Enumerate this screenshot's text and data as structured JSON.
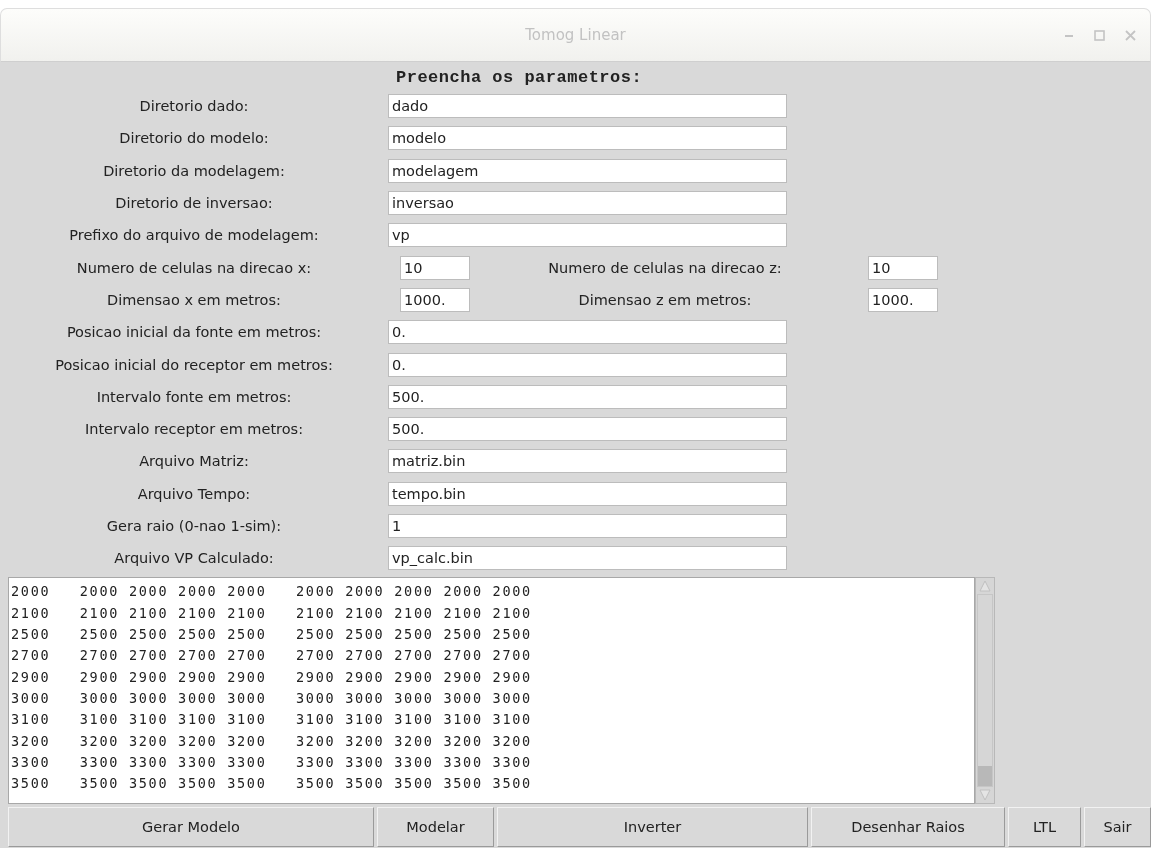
{
  "window": {
    "title": "Tomog Linear"
  },
  "heading": "Preencha os parametros:",
  "rows": [
    {
      "kind": "single",
      "label": "Diretorio dado:",
      "value": "dado"
    },
    {
      "kind": "single",
      "label": "Diretorio do modelo:",
      "value": "modelo"
    },
    {
      "kind": "single",
      "label": "Diretorio da modelagem:",
      "value": "modelagem"
    },
    {
      "kind": "single",
      "label": "Diretorio de inversao:",
      "value": "inversao"
    },
    {
      "kind": "single",
      "label": "Prefixo do arquivo de modelagem:",
      "value": "vp"
    },
    {
      "kind": "pair",
      "label": "Numero de celulas na direcao x:",
      "value": "10",
      "label_2": "Numero de celulas na direcao z:",
      "value_2": "10"
    },
    {
      "kind": "pair",
      "label": "Dimensao x em metros:",
      "value": "1000.",
      "label_2": "Dimensao z em metros:",
      "value_2": "1000."
    },
    {
      "kind": "single",
      "label": "Posicao inicial da fonte em metros:",
      "value": "0."
    },
    {
      "kind": "single",
      "label": "Posicao inicial do receptor em metros:",
      "value": "0."
    },
    {
      "kind": "single",
      "label": "Intervalo fonte em metros:",
      "value": "500."
    },
    {
      "kind": "single",
      "label": "Intervalo receptor em metros:",
      "value": "500."
    },
    {
      "kind": "single",
      "label": "Arquivo Matriz:",
      "value": "matriz.bin"
    },
    {
      "kind": "single",
      "label": "Arquivo Tempo:",
      "value": "tempo.bin"
    },
    {
      "kind": "single",
      "label": "Gera raio (0-nao 1-sim):",
      "value": "1"
    },
    {
      "kind": "single",
      "label": "Arquivo VP Calculado:",
      "value": "vp_calc.bin"
    }
  ],
  "output_lines": [
    "2000   2000 2000 2000 2000   2000 2000 2000 2000 2000",
    "2100   2100 2100 2100 2100   2100 2100 2100 2100 2100",
    "2500   2500 2500 2500 2500   2500 2500 2500 2500 2500",
    "2700   2700 2700 2700 2700   2700 2700 2700 2700 2700",
    "2900   2900 2900 2900 2900   2900 2900 2900 2900 2900",
    "3000   3000 3000 3000 3000   3000 3000 3000 3000 3000",
    "3100   3100 3100 3100 3100   3100 3100 3100 3100 3100",
    "3200   3200 3200 3200 3200   3200 3200 3200 3200 3200",
    "3300   3300 3300 3300 3300   3300 3300 3300 3300 3300",
    "3500   3500 3500 3500 3500   3500 3500 3500 3500 3500"
  ],
  "buttons": [
    "Gerar Modelo",
    "Modelar",
    "Inverter",
    "Desenhar Raios",
    "LTL",
    "Sair"
  ]
}
